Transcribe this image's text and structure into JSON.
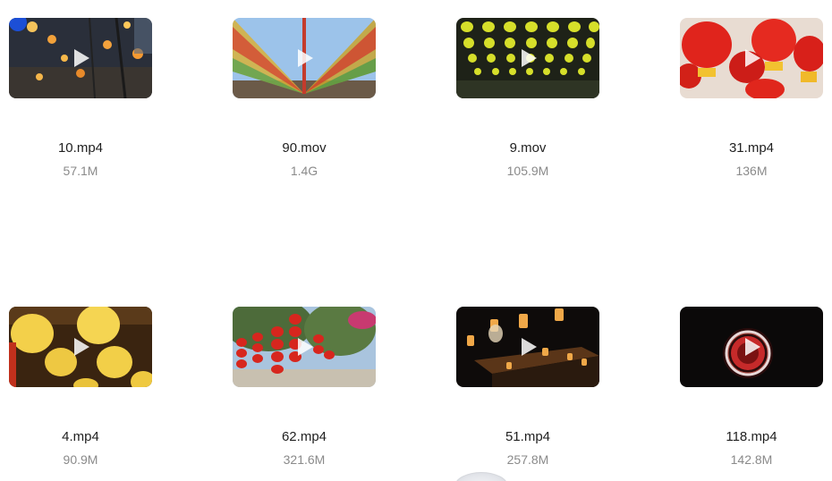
{
  "files": [
    {
      "name": "10.mp4",
      "size": "57.1M",
      "thumb_icon": "night-street-lanterns-thumbnail"
    },
    {
      "name": "90.mov",
      "size": "1.4G",
      "thumb_icon": "hanging-lantern-rows-thumbnail"
    },
    {
      "name": "9.mov",
      "size": "105.9M",
      "thumb_icon": "yellow-lantern-grid-thumbnail"
    },
    {
      "name": "31.mp4",
      "size": "136M",
      "thumb_icon": "red-lanterns-thumbnail"
    },
    {
      "name": "4.mp4",
      "size": "90.9M",
      "thumb_icon": "yellow-paper-lanterns-thumbnail"
    },
    {
      "name": "62.mp4",
      "size": "321.6M",
      "thumb_icon": "red-lanterns-trees-thumbnail"
    },
    {
      "name": "51.mp4",
      "size": "257.8M",
      "thumb_icon": "night-building-lanterns-thumbnail"
    },
    {
      "name": "118.mp4",
      "size": "142.8M",
      "thumb_icon": "single-red-lantern-thumbnail"
    }
  ],
  "play_icon": "play-icon"
}
